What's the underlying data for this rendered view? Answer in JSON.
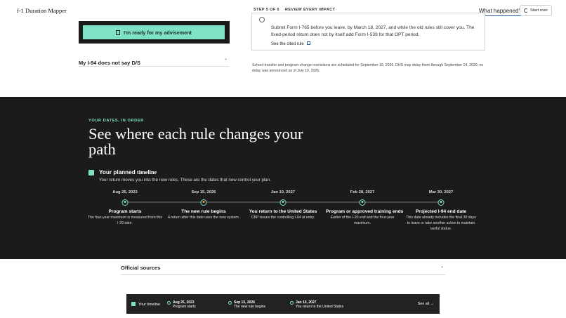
{
  "header": {
    "logo": "f-1 Duration Mapper",
    "step_label": "Step 5 of 6",
    "step_title": "Review every impact",
    "step_total": 6,
    "step_current": 5,
    "what_happened": "What happened?",
    "start_over": "Start over"
  },
  "left_panel": {
    "ready_button": "I'm ready for my advisement",
    "accordion_title": "My I-94 does not say D/S"
  },
  "step_card": {
    "body": "Submit Form I-765 before you leave, by March 18, 2027, and while the old rules still cover you. The fixed-period return does not by itself add Form I-539 for that OPT period.",
    "link": "See the cited rule"
  },
  "school_note": "School-transfer and program-change restrictions are scheduled for September 15, 2026. DHS may delay them through September 14, 2029; no delay was announced as of July 19, 2026.",
  "timeline": {
    "kicker": "Your dates, in order",
    "headline": "See where each rule changes your path",
    "planned_title": "Your planned",
    "planned_title_b": "timeline",
    "planned_sub": "Your return moves you into the new rules. These are the dates that now control your plan.",
    "dates": [
      "Aug 25, 2023",
      "Sep 15, 2026",
      "Jan 10, 2027",
      "Feb 28, 2027",
      "Mar 30, 2027"
    ],
    "events": [
      {
        "title": "Program starts",
        "desc": "The four-year maximum is measured from this I-20 date."
      },
      {
        "title": "The new rule begins",
        "desc": "A return after this date uses the new system."
      },
      {
        "title": "You return to the United States",
        "desc": "CBP issues the controlling I-94 at entry."
      },
      {
        "title": "Program or approved training ends",
        "desc": "Earlier of the I-20 end and the four-year maximum."
      },
      {
        "title": "Projected I-94 end date",
        "desc": "This date already includes the final 30 days to leave or take another action to maintain lawful status."
      }
    ]
  },
  "sources": {
    "title": "Official sources"
  },
  "mini_bar": {
    "label": "Your timeline",
    "items": [
      {
        "date": "Aug 25, 2023",
        "text": "Program starts"
      },
      {
        "date": "Sep 15, 2026",
        "text": "The new rule begins"
      },
      {
        "date": "Jan 10, 2027",
        "text": "You return to the United States"
      }
    ],
    "see_all": "See all →"
  },
  "colors": {
    "accent": "#7ee2c6",
    "primary": "#2d5a9c",
    "dark_bg": "#1b1b1b",
    "warning": "#f0a040"
  }
}
